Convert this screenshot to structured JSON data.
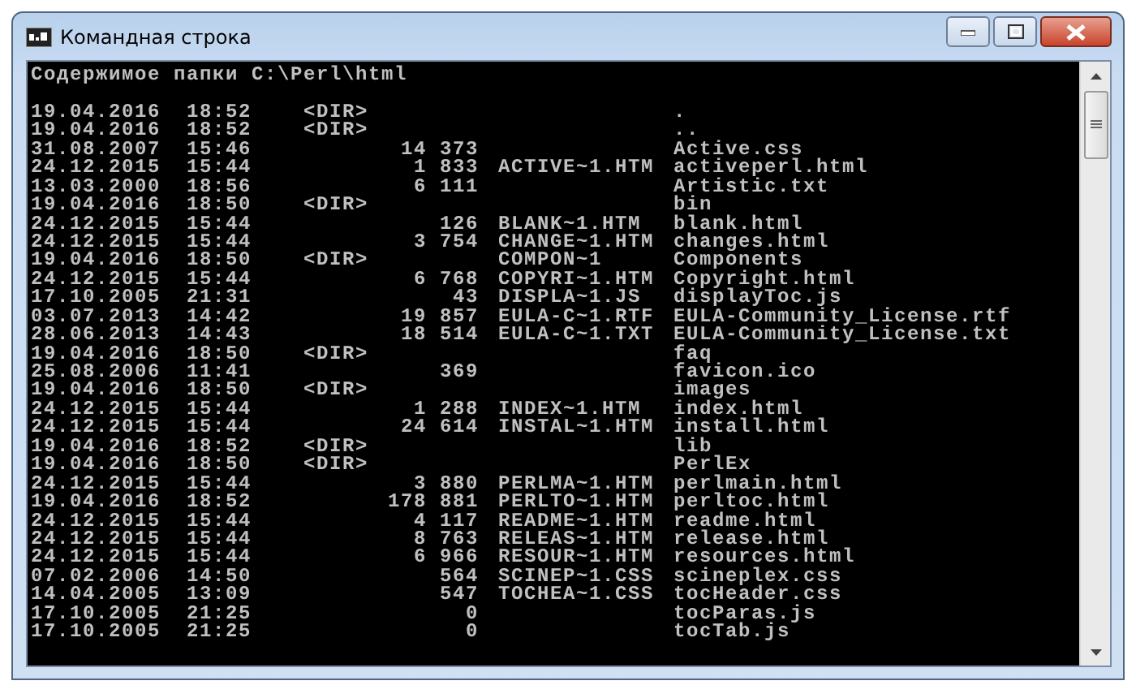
{
  "window": {
    "title": "Командная строка"
  },
  "console": {
    "header": "Содержимое папки C:\\Perl\\html",
    "entries": [
      {
        "date": "19.04.2016",
        "time": "18:52",
        "kind": "dir",
        "tag": "<DIR>",
        "name": "."
      },
      {
        "date": "19.04.2016",
        "time": "18:52",
        "kind": "dir",
        "tag": "<DIR>",
        "name": ".."
      },
      {
        "date": "31.08.2007",
        "time": "15:46",
        "kind": "file",
        "size": "14 373",
        "name": "Active.css"
      },
      {
        "date": "24.12.2015",
        "time": "15:44",
        "kind": "file",
        "size": "1 833",
        "short_name": "ACTIVE~1.HTM",
        "name": "activeperl.html"
      },
      {
        "date": "13.03.2000",
        "time": "18:56",
        "kind": "file",
        "size": "6 111",
        "name": "Artistic.txt"
      },
      {
        "date": "19.04.2016",
        "time": "18:50",
        "kind": "dir",
        "tag": "<DIR>",
        "name": "bin"
      },
      {
        "date": "24.12.2015",
        "time": "15:44",
        "kind": "file",
        "size": "126",
        "short_name": "BLANK~1.HTM",
        "name": "blank.html"
      },
      {
        "date": "24.12.2015",
        "time": "15:44",
        "kind": "file",
        "size": "3 754",
        "short_name": "CHANGE~1.HTM",
        "name": "changes.html"
      },
      {
        "date": "19.04.2016",
        "time": "18:50",
        "kind": "dir",
        "tag": "<DIR>",
        "short_name": "COMPON~1",
        "name": "Components"
      },
      {
        "date": "24.12.2015",
        "time": "15:44",
        "kind": "file",
        "size": "6 768",
        "short_name": "COPYRI~1.HTM",
        "name": "Copyright.html"
      },
      {
        "date": "17.10.2005",
        "time": "21:31",
        "kind": "file",
        "size": "43",
        "short_name": "DISPLA~1.JS",
        "name": "displayToc.js"
      },
      {
        "date": "03.07.2013",
        "time": "14:42",
        "kind": "file",
        "size": "19 857",
        "short_name": "EULA-C~1.RTF",
        "name": "EULA-Community_License.rtf"
      },
      {
        "date": "28.06.2013",
        "time": "14:43",
        "kind": "file",
        "size": "18 514",
        "short_name": "EULA-C~1.TXT",
        "name": "EULA-Community_License.txt"
      },
      {
        "date": "19.04.2016",
        "time": "18:50",
        "kind": "dir",
        "tag": "<DIR>",
        "name": "faq"
      },
      {
        "date": "25.08.2006",
        "time": "11:41",
        "kind": "file",
        "size": "369",
        "name": "favicon.ico"
      },
      {
        "date": "19.04.2016",
        "time": "18:50",
        "kind": "dir",
        "tag": "<DIR>",
        "name": "images"
      },
      {
        "date": "24.12.2015",
        "time": "15:44",
        "kind": "file",
        "size": "1 288",
        "short_name": "INDEX~1.HTM",
        "name": "index.html"
      },
      {
        "date": "24.12.2015",
        "time": "15:44",
        "kind": "file",
        "size": "24 614",
        "short_name": "INSTAL~1.HTM",
        "name": "install.html"
      },
      {
        "date": "19.04.2016",
        "time": "18:52",
        "kind": "dir",
        "tag": "<DIR>",
        "name": "lib"
      },
      {
        "date": "19.04.2016",
        "time": "18:50",
        "kind": "dir",
        "tag": "<DIR>",
        "name": "PerlEx"
      },
      {
        "date": "24.12.2015",
        "time": "15:44",
        "kind": "file",
        "size": "3 880",
        "short_name": "PERLMA~1.HTM",
        "name": "perlmain.html"
      },
      {
        "date": "19.04.2016",
        "time": "18:52",
        "kind": "file",
        "size": "178 881",
        "short_name": "PERLTO~1.HTM",
        "name": "perltoc.html"
      },
      {
        "date": "24.12.2015",
        "time": "15:44",
        "kind": "file",
        "size": "4 117",
        "short_name": "README~1.HTM",
        "name": "readme.html"
      },
      {
        "date": "24.12.2015",
        "time": "15:44",
        "kind": "file",
        "size": "8 763",
        "short_name": "RELEAS~1.HTM",
        "name": "release.html"
      },
      {
        "date": "24.12.2015",
        "time": "15:44",
        "kind": "file",
        "size": "6 966",
        "short_name": "RESOUR~1.HTM",
        "name": "resources.html"
      },
      {
        "date": "07.02.2006",
        "time": "14:50",
        "kind": "file",
        "size": "564",
        "short_name": "SCINEP~1.CSS",
        "name": "scineplex.css"
      },
      {
        "date": "14.04.2005",
        "time": "13:09",
        "kind": "file",
        "size": "547",
        "short_name": "TOCHEA~1.CSS",
        "name": "tocHeader.css"
      },
      {
        "date": "17.10.2005",
        "time": "21:25",
        "kind": "file",
        "size": "0",
        "name": "tocParas.js"
      },
      {
        "date": "17.10.2005",
        "time": "21:25",
        "kind": "file",
        "size": "0",
        "name": "tocTab.js"
      }
    ]
  }
}
